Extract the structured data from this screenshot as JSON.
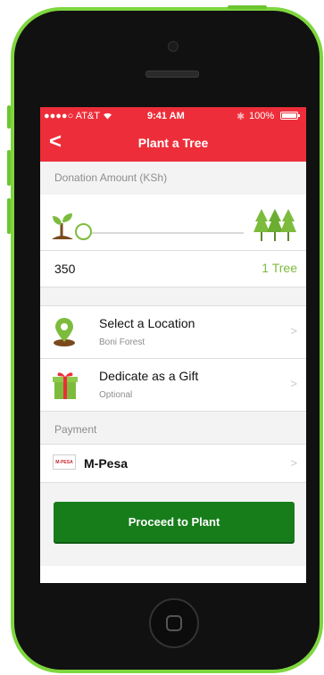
{
  "status_bar": {
    "carrier": "●●●●○ AT&T",
    "wifi_icon": "wifi-icon",
    "time": "9:41 AM",
    "bluetooth_symbol": "✱",
    "battery": "100%"
  },
  "navbar": {
    "back_symbol": "<",
    "title": "Plant a Tree"
  },
  "donation": {
    "section_title": "Donation Amount (KSh)",
    "amount": "350",
    "trees": "1 Tree",
    "slider_value_fraction": 0.0
  },
  "location": {
    "title": "Select a Location",
    "subtitle": "Boni Forest",
    "icon": "map-pin-icon"
  },
  "gift": {
    "title": "Dedicate as a Gift",
    "subtitle": "Optional",
    "icon": "gift-icon"
  },
  "payment": {
    "section_title": "Payment",
    "method": "M-Pesa",
    "logo_text": "M-PESA"
  },
  "proceed_label": "Proceed to Plant",
  "chevron": ">",
  "colors": {
    "brand_red": "#ed2e3a",
    "green": "#7dbb3d",
    "button_green": "#177d1a",
    "phone_body": "#7ed63e"
  }
}
